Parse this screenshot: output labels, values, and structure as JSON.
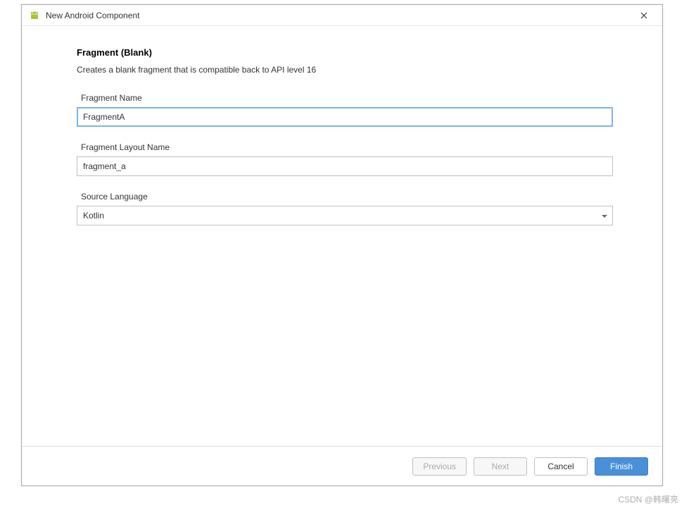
{
  "window": {
    "title": "New Android Component"
  },
  "content": {
    "heading": "Fragment (Blank)",
    "description": "Creates a blank fragment that is compatible back to API level 16",
    "fields": {
      "fragment_name": {
        "label": "Fragment Name",
        "value": "FragmentA"
      },
      "layout_name": {
        "label": "Fragment Layout Name",
        "value": "fragment_a"
      },
      "source_language": {
        "label": "Source Language",
        "value": "Kotlin"
      }
    }
  },
  "footer": {
    "previous": "Previous",
    "next": "Next",
    "cancel": "Cancel",
    "finish": "Finish"
  },
  "watermark": "CSDN @韩曙亮"
}
